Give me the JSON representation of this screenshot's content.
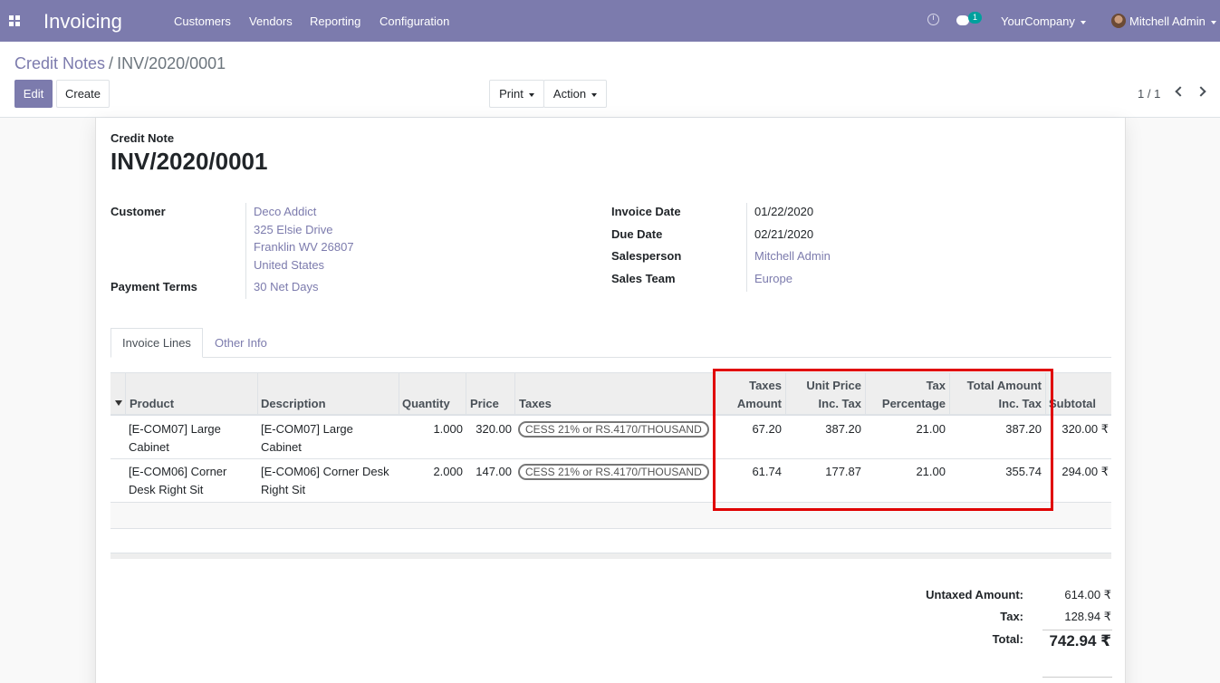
{
  "nav": {
    "app_title": "Invoicing",
    "menu": [
      "Customers",
      "Vendors",
      "Reporting",
      "Configuration"
    ],
    "chat_count": "1",
    "company": "YourCompany",
    "user": "Mitchell Admin"
  },
  "control": {
    "breadcrumb_parent": "Credit Notes",
    "breadcrumb_sep": "/",
    "breadcrumb_current": "INV/2020/0001",
    "edit_label": "Edit",
    "create_label": "Create",
    "print_label": "Print",
    "action_label": "Action",
    "pager": "1 / 1"
  },
  "doc": {
    "type": "Credit Note",
    "name": "INV/2020/0001",
    "customer_label": "Customer",
    "customer_name": "Deco Addict",
    "customer_address": [
      "325 Elsie Drive",
      "Franklin WV 26807",
      "United States"
    ],
    "payment_terms_label": "Payment Terms",
    "payment_terms": "30 Net Days",
    "invoice_date_label": "Invoice Date",
    "invoice_date": "01/22/2020",
    "due_date_label": "Due Date",
    "due_date": "02/21/2020",
    "salesperson_label": "Salesperson",
    "salesperson": "Mitchell Admin",
    "sales_team_label": "Sales Team",
    "sales_team": "Europe"
  },
  "tabs": {
    "active": "Invoice Lines",
    "other": "Other Info"
  },
  "table": {
    "headers": {
      "product": "Product",
      "description": "Description",
      "quantity": "Quantity",
      "price": "Price",
      "taxes": "Taxes",
      "taxes_amount_1": "Taxes",
      "taxes_amount_2": "Amount",
      "unit_price_1": "Unit Price",
      "unit_price_2": "Inc. Tax",
      "tax_pct_1": "Tax",
      "tax_pct_2": "Percentage",
      "total_1": "Total Amount",
      "total_2": "Inc. Tax",
      "subtotal": "Subtotal"
    },
    "rows": [
      {
        "product_1": "[E-COM07] Large",
        "product_2": "Cabinet",
        "desc_1": "[E-COM07] Large",
        "desc_2": "Cabinet",
        "quantity": "1.000",
        "price": "320.00",
        "tax": "CESS 21% or RS.4170/THOUSAND",
        "taxes_amount": "67.20",
        "unit_price_inc": "387.20",
        "tax_pct": "21.00",
        "total_inc": "387.20",
        "subtotal": "320.00 ₹"
      },
      {
        "product_1": "[E-COM06] Corner",
        "product_2": "Desk Right Sit",
        "desc_1": "[E-COM06] Corner Desk",
        "desc_2": "Right Sit",
        "quantity": "2.000",
        "price": "147.00",
        "tax": "CESS 21% or RS.4170/THOUSAND",
        "taxes_amount": "61.74",
        "unit_price_inc": "177.87",
        "tax_pct": "21.00",
        "total_inc": "355.74",
        "subtotal": "294.00 ₹"
      }
    ]
  },
  "totals": {
    "untaxed_label": "Untaxed Amount:",
    "untaxed": "614.00 ₹",
    "tax_label": "Tax:",
    "tax": "128.94 ₹",
    "total_label": "Total:",
    "total": "742.94 ₹"
  },
  "colors": {
    "brand": "#7c7bad",
    "highlight": "#e00000"
  }
}
